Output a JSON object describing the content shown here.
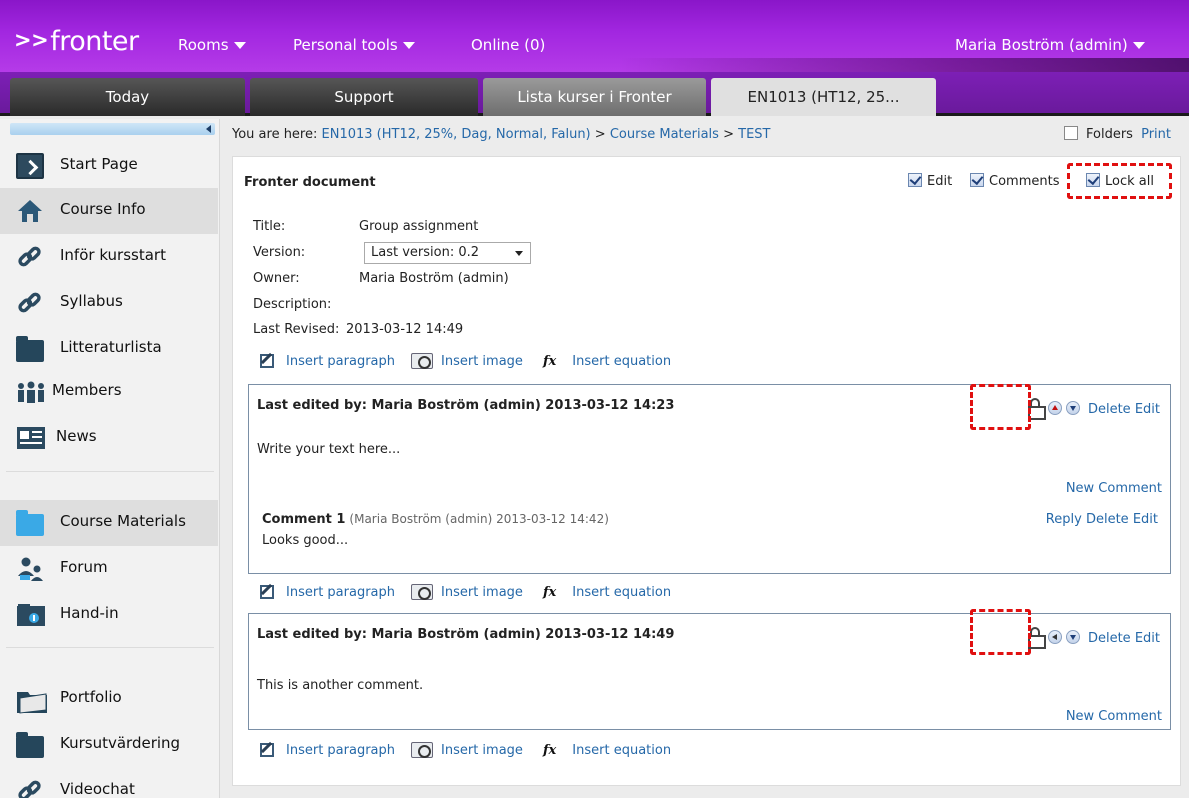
{
  "header": {
    "logo_arrows": ">>",
    "logo_text": "fronter",
    "nav": {
      "rooms": "Rooms",
      "personal_tools": "Personal tools",
      "online": "Online (0)"
    },
    "user": "Maria Boström (admin)"
  },
  "tabs": [
    "Today",
    "Support",
    "Lista kurser i Fronter",
    "EN1013 (HT12, 25..."
  ],
  "sidebar": {
    "items": [
      {
        "label": "Start Page",
        "icon": "start-page-icon"
      },
      {
        "label": "Course Info",
        "icon": "home-icon"
      },
      {
        "label": "Inför kursstart",
        "icon": "link-icon"
      },
      {
        "label": "Syllabus",
        "icon": "link-icon"
      },
      {
        "label": "Litteraturlista",
        "icon": "folder-icon"
      },
      {
        "label": "Members",
        "icon": "members-icon"
      },
      {
        "label": "News",
        "icon": "news-icon"
      },
      {
        "label": "Course Materials",
        "icon": "folder-icon"
      },
      {
        "label": "Forum",
        "icon": "forum-icon"
      },
      {
        "label": "Hand-in",
        "icon": "hand-in-icon"
      },
      {
        "label": "Portfolio",
        "icon": "portfolio-icon"
      },
      {
        "label": "Kursutvärdering",
        "icon": "folder-icon"
      },
      {
        "label": "Videochat",
        "icon": "link-icon"
      }
    ]
  },
  "breadcrumb": {
    "prefix": "You are here:",
    "course": "EN1013 (HT12, 25%, Dag, Normal, Falun)",
    "sep1": ">",
    "materials": "Course Materials",
    "sep2": ">",
    "current": "TEST"
  },
  "folders_label": "Folders",
  "print_label": "Print",
  "doc": {
    "heading": "Fronter document",
    "options": {
      "edit": "Edit",
      "comments": "Comments",
      "lock_all": "Lock all"
    },
    "meta": {
      "title_label": "Title:",
      "title_value": "Group assignment",
      "version_label": "Version:",
      "version_value": "Last version: 0.2",
      "owner_label": "Owner:",
      "owner_value": "Maria Boström (admin)",
      "description_label": "Description:",
      "revised_label": "Last Revised:",
      "revised_value": "2013-03-12 14:49"
    },
    "insert": {
      "paragraph": "Insert paragraph",
      "image": "Insert image",
      "fx": "fx",
      "equation": "Insert equation"
    },
    "paragraphs": [
      {
        "header": "Last edited by: Maria Boström (admin) 2013-03-12 14:23",
        "text": "Write your text here...",
        "delete": "Delete",
        "edit": "Edit",
        "new_comment": "New Comment",
        "comment": {
          "title": "Comment 1",
          "meta": "(Maria Boström (admin) 2013-03-12 14:42)",
          "reply": "Reply",
          "delete": "Delete",
          "edit": "Edit",
          "text": "Looks good..."
        }
      },
      {
        "header": "Last edited by: Maria Boström (admin) 2013-03-12 14:49",
        "text": "This is another comment.",
        "delete": "Delete",
        "edit": "Edit",
        "new_comment": "New Comment"
      }
    ]
  },
  "colors": {
    "header_purple": "#a227e0",
    "link_blue": "#2568a8",
    "highlight_red": "#e01010"
  }
}
